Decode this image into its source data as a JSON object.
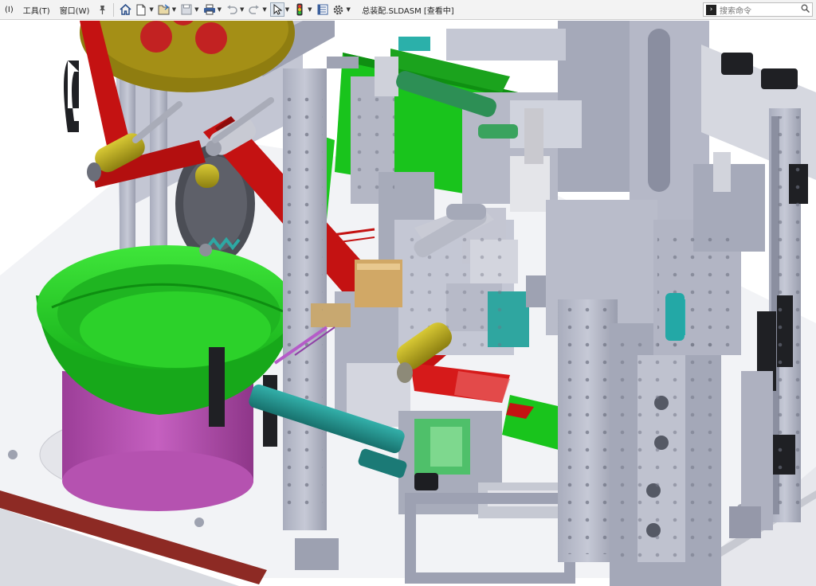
{
  "menu": {
    "items": [
      "(I)",
      "工具(T)",
      "窗口(W)"
    ]
  },
  "toolbar": {
    "icons": [
      "pin-icon",
      "home-icon",
      "new-document-icon",
      "open-icon",
      "save-icon",
      "print-icon",
      "undo-icon",
      "redo-icon",
      "select-cursor-icon",
      "traffic-light-icon",
      "file-properties-icon",
      "options-gear-icon"
    ]
  },
  "window": {
    "title": "总装配.SLDASM [查看中]"
  },
  "search": {
    "placeholder": "搜索命令"
  },
  "colors": {
    "frame_gray": "#b9bccb",
    "frame_dark": "#8e92a3",
    "belt_red": "#c41212",
    "plate_green": "#19c41c",
    "bowl_green": "#2fd72a",
    "base_magenta": "#b552b0",
    "cylinder_teal": "#1f8f8a",
    "roller_olive": "#b2a318"
  }
}
